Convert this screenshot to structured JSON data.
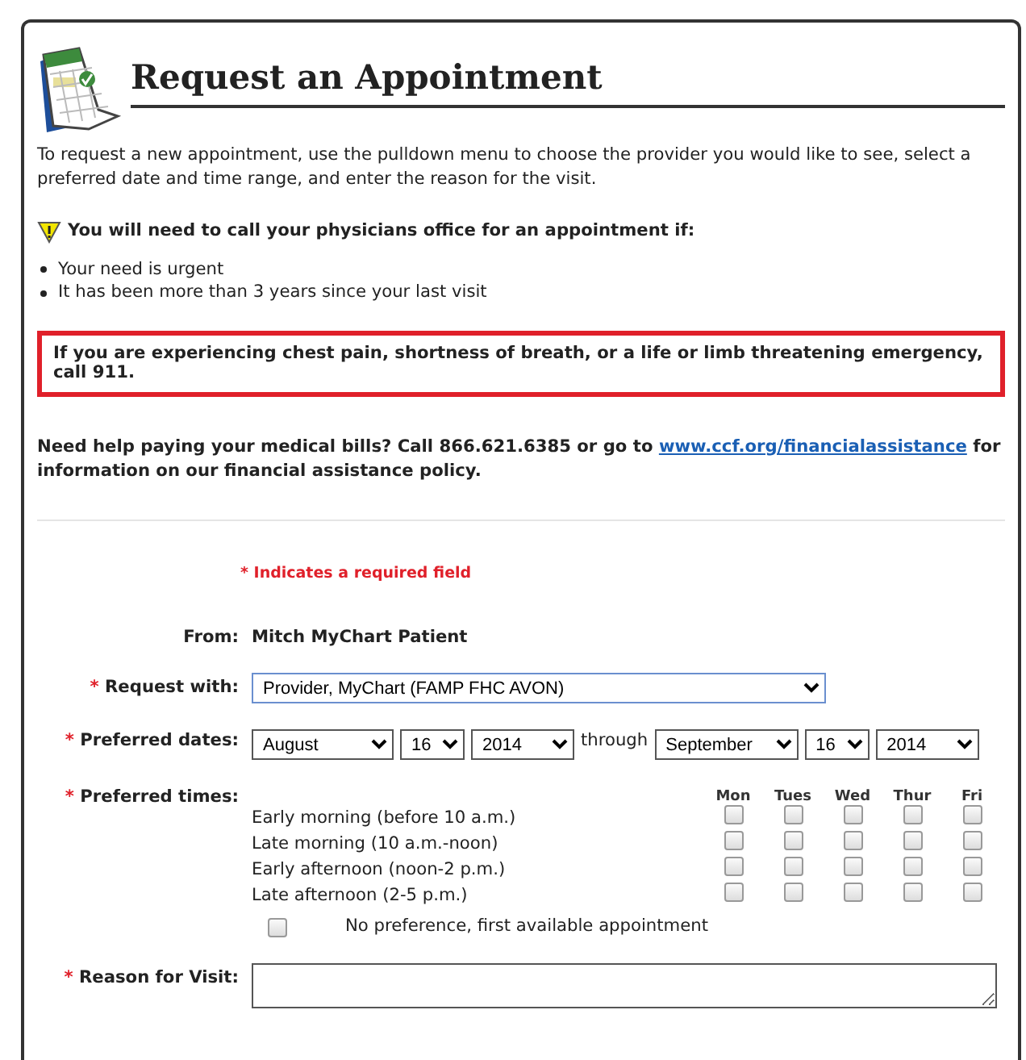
{
  "title": "Request an Appointment",
  "intro": "To request a new appointment, use the pulldown menu to choose the provider you would like to see, select a preferred date and time range, and enter the reason for the visit.",
  "warning": {
    "heading": "You will need to call your physicians office for an appointment if:",
    "items": [
      "Your need is urgent",
      "It has been more than 3 years since your last visit"
    ]
  },
  "emergency": "If you are experiencing chest pain, shortness of breath, or a life or limb threatening emergency, call 911.",
  "help": {
    "before": "Need help paying your medical bills? Call 866.621.6385 or go to",
    "link": "www.ccf.org/financialassistance",
    "after": "for information on our financial assistance policy."
  },
  "required_note": {
    "mark": "*",
    "text": "Indicates a required field"
  },
  "fields": [
    {
      "kind": "text",
      "label": "From:",
      "required": false,
      "value": "Mitch MyChart Patient"
    },
    {
      "kind": "provider",
      "label": "Request with:",
      "required": true,
      "value": "Provider, MyChart  (FAMP FHC AVON)"
    },
    {
      "kind": "dates",
      "label": "Preferred dates:",
      "required": true,
      "start": [
        "August",
        "16",
        "2014"
      ],
      "joiner": "through",
      "end": [
        "September",
        "16",
        "2014"
      ]
    },
    {
      "kind": "times",
      "label": "Preferred times:",
      "required": true,
      "days": [
        "Mon",
        "Tues",
        "Wed",
        "Thur",
        "Fri"
      ],
      "rows": [
        {
          "label": "Early morning (before 10 a.m.)",
          "slots": [
            {
              "checked": false
            },
            {
              "checked": false
            },
            {
              "checked": false
            },
            {
              "checked": false
            },
            {
              "checked": false
            }
          ]
        },
        {
          "label": "Late morning (10 a.m.-noon)",
          "slots": [
            {
              "checked": false
            },
            {
              "checked": false
            },
            {
              "checked": false
            },
            {
              "checked": false
            },
            {
              "checked": false
            }
          ]
        },
        {
          "label": "Early afternoon (noon-2 p.m.)",
          "slots": [
            {
              "checked": false
            },
            {
              "checked": false
            },
            {
              "checked": false
            },
            {
              "checked": false
            },
            {
              "checked": false
            }
          ]
        },
        {
          "label": "Late afternoon (2-5 p.m.)",
          "slots": [
            {
              "checked": false
            },
            {
              "checked": false
            },
            {
              "checked": false
            },
            {
              "checked": false
            },
            {
              "checked": false
            }
          ]
        }
      ],
      "no_preference": {
        "label": "No preference, first available appointment",
        "checked": false
      }
    },
    {
      "kind": "textarea",
      "label": "Reason for Visit:",
      "required": true
    }
  ]
}
